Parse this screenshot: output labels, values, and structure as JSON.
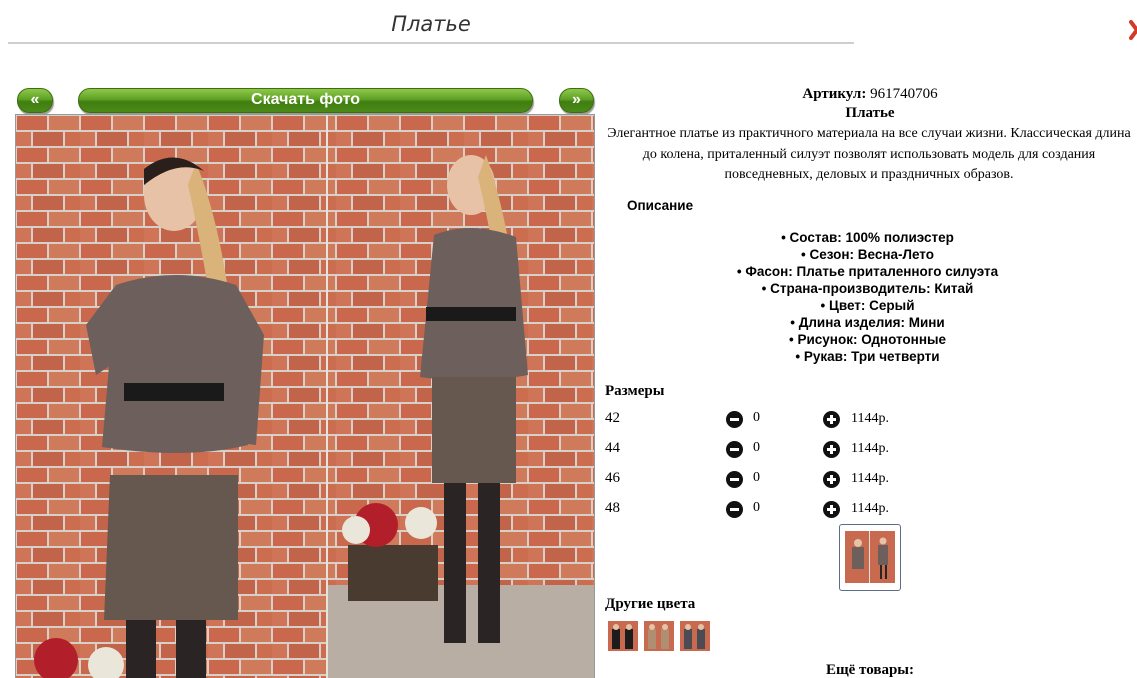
{
  "page": {
    "title": "Платье"
  },
  "nav": {
    "prev_label": "«",
    "download_label": "Скачать фото",
    "next_label": "»"
  },
  "product": {
    "article_label": "Артикул:",
    "article_value": "961740706",
    "name": "Платье",
    "description": "Элегантное платье из практичного материала на все случаи жизни. Классическая длина до колена, приталенный силуэт позволят использовать модель для создания повседневных, деловых и праздничных образов.",
    "description_heading": "Описание",
    "attributes": [
      "Состав: 100% полиэстер",
      "Сезон: Весна-Лето",
      "Фасон: Платье приталенного силуэта",
      "Страна-производитель: Китай",
      "Цвет: Серый",
      "Длина изделия: Мини",
      "Рисунок: Однотонные",
      "Рукав: Три четверти"
    ]
  },
  "sizes": {
    "heading": "Размеры",
    "rows": [
      {
        "size": "42",
        "qty": "0",
        "price": "1144р."
      },
      {
        "size": "44",
        "qty": "0",
        "price": "1144р."
      },
      {
        "size": "46",
        "qty": "0",
        "price": "1144р."
      },
      {
        "size": "48",
        "qty": "0",
        "price": "1144р."
      }
    ]
  },
  "other_colors": {
    "heading": "Другие цвета",
    "swatches": [
      "black",
      "beige",
      "grey"
    ]
  },
  "more": {
    "heading": "Ещё товары:"
  },
  "colors": {
    "accent_green": "#5ea125",
    "brick": "#c86a4f",
    "dress": "#6d5f5c",
    "close_red": "#d23a2a"
  },
  "icons": {
    "minus": "minus-circle-icon",
    "plus": "plus-circle-icon",
    "close": "close-icon"
  }
}
